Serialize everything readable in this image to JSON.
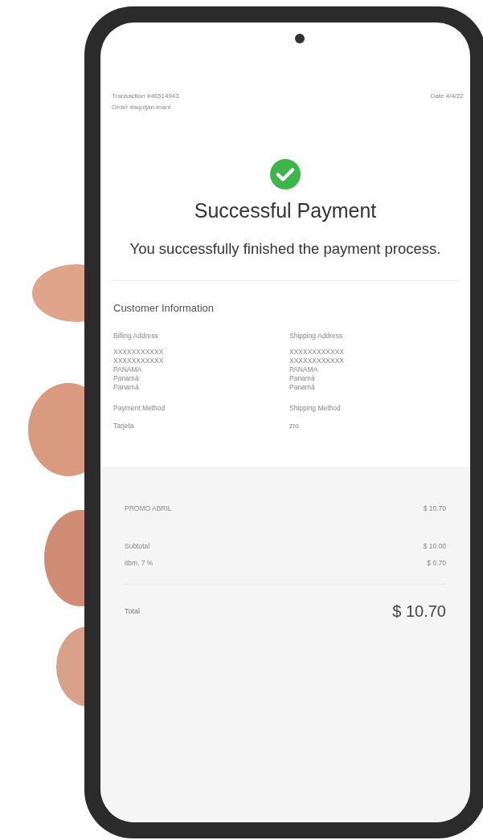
{
  "header": {
    "transaction": "Transaction #46514943",
    "order": "Order #aquijan-mant",
    "date": "Date 4/4/22"
  },
  "status": {
    "title": "Successful Payment",
    "message": "You successfully finished the payment process."
  },
  "customer_information": {
    "title": "Customer Information",
    "columns": [
      {
        "heading": "Billing Address",
        "lines": [
          "XXXXXXXXXXX",
          "XXXXXXXXXXX",
          "PANAMA",
          "Panamá",
          "Panamá"
        ],
        "method_label": "Payment Method",
        "method_value": "Tarjeta"
      },
      {
        "heading": "Shipping Address",
        "lines": [
          "XXXXXXXXXXXX",
          "XXXXXXXXXXXX",
          "PANAMA",
          "Panamá",
          "Panamá"
        ],
        "method_label": "Shipping Method",
        "method_value": "zro"
      }
    ]
  },
  "summary": {
    "items": [
      {
        "label": "PROMO ABRIL",
        "amount": "$ 10.70"
      }
    ],
    "totals": [
      {
        "label": "Subtotal",
        "amount": "$ 10.00"
      },
      {
        "label": "itbm, 7 %",
        "amount": "$ 0.70"
      }
    ],
    "total": {
      "label": "Total",
      "amount": "$ 10.70"
    }
  }
}
